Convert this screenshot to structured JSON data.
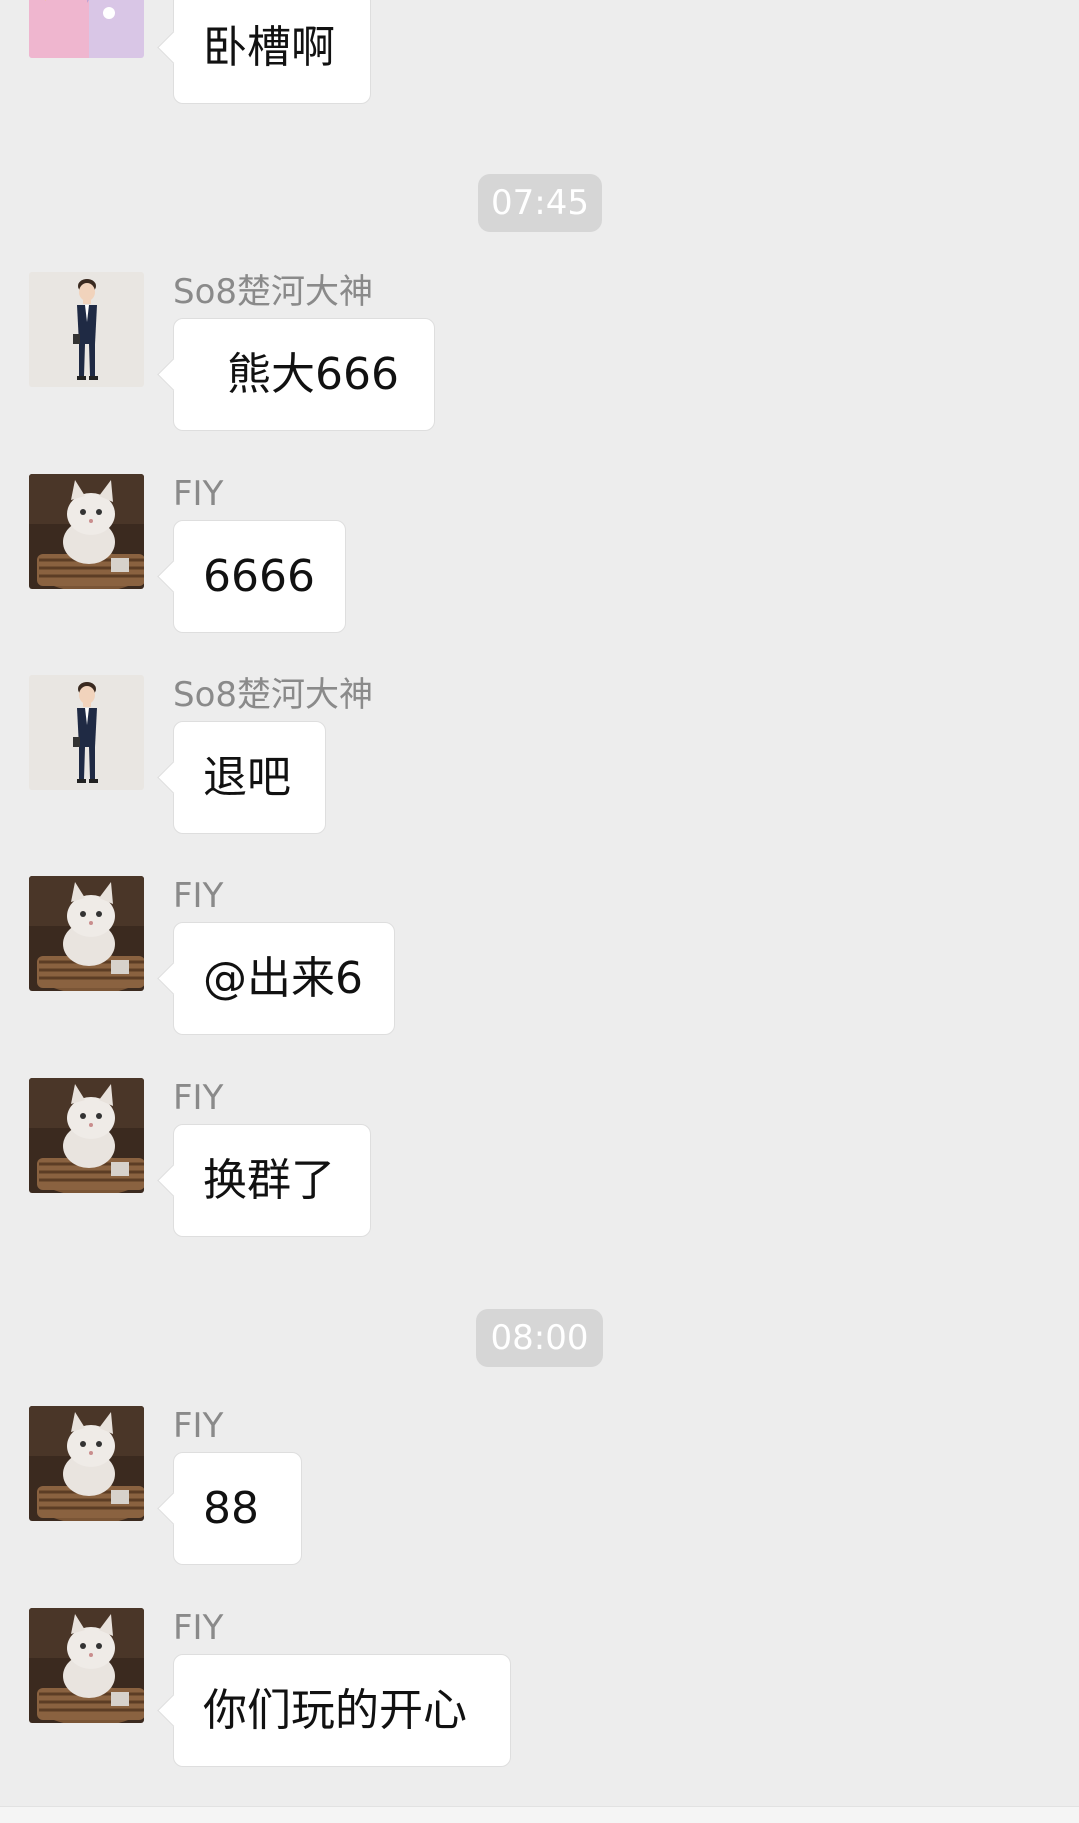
{
  "messages": [
    {
      "sender": "",
      "text": "卧槽啊",
      "avatar": "anime-avatar"
    },
    {
      "sender": "So8楚河大神",
      "text": "熊大666",
      "avatar": "man-suit-avatar"
    },
    {
      "sender": "FIY",
      "text": "6666",
      "avatar": "kitten-avatar"
    },
    {
      "sender": "So8楚河大神",
      "text": "退吧",
      "avatar": "man-suit-avatar"
    },
    {
      "sender": "FIY",
      "text": "@出来6",
      "avatar": "kitten-avatar"
    },
    {
      "sender": "FIY",
      "text": "换群了",
      "avatar": "kitten-avatar"
    },
    {
      "sender": "FIY",
      "text": "88",
      "avatar": "kitten-avatar"
    },
    {
      "sender": "FIY",
      "text": "你们玩的开心",
      "avatar": "kitten-avatar"
    }
  ],
  "timestamps": [
    "07:45",
    "08:00"
  ],
  "colors": {
    "background": "#ededed",
    "bubble": "#ffffff",
    "sender_name": "#8a8a8a",
    "timestamp_bg": "#d6d6d6"
  }
}
